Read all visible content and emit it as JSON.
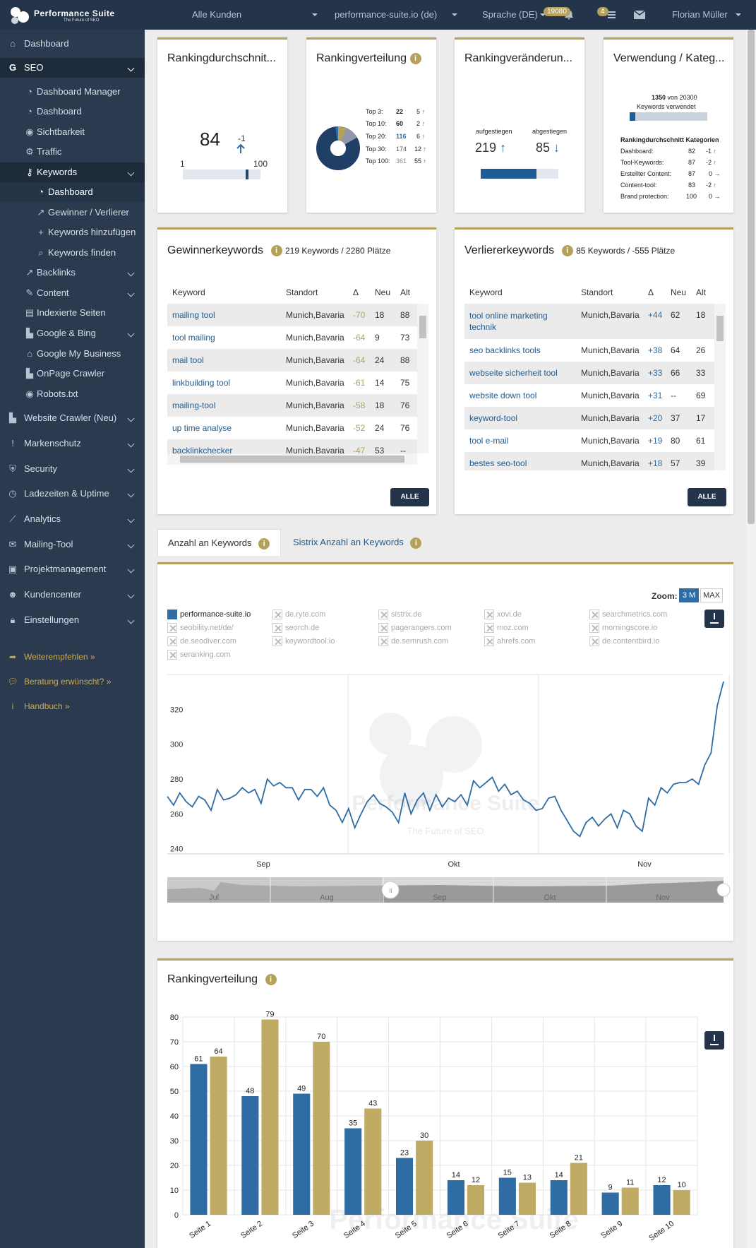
{
  "topbar": {
    "brand": "Performance Suite",
    "tagline": "The Future of SEO",
    "customer": "Alle Kunden",
    "domain": "performance-suite.io (de)",
    "language": "Sprache (DE)",
    "credits": "19080",
    "notifications": "4",
    "user": "Florian Müller"
  },
  "sidebar": {
    "items": [
      {
        "label": "Dashboard",
        "icon": "home-icon"
      },
      {
        "label": "SEO",
        "icon": "google-icon"
      },
      {
        "label": "Dashboard Manager",
        "icon": "dashboard-icon"
      },
      {
        "label": "Dashboard",
        "icon": "dashboard-icon"
      },
      {
        "label": "Sichtbarkeit",
        "icon": "eye-icon"
      },
      {
        "label": "Traffic",
        "icon": "cogs-icon"
      },
      {
        "label": "Keywords",
        "icon": "key-icon"
      },
      {
        "label": "Dashboard",
        "icon": "dashboard-icon"
      },
      {
        "label": "Gewinner / Verlierer",
        "icon": "external-link-icon"
      },
      {
        "label": "Keywords hinzufügen",
        "icon": "plus-icon"
      },
      {
        "label": "Keywords finden",
        "icon": "search-icon"
      },
      {
        "label": "Backlinks",
        "icon": "external-link-icon"
      },
      {
        "label": "Content",
        "icon": "pencil-icon"
      },
      {
        "label": "Indexierte Seiten",
        "icon": "file-icon"
      },
      {
        "label": "Google & Bing",
        "icon": "chart-icon"
      },
      {
        "label": "Google My Business",
        "icon": "store-icon"
      },
      {
        "label": "OnPage Crawler",
        "icon": "chart-icon"
      },
      {
        "label": "Robots.txt",
        "icon": "eye-icon"
      },
      {
        "label": "Website Crawler (Neu)",
        "icon": "chart-icon"
      },
      {
        "label": "Markenschutz",
        "icon": "exclamation-icon"
      },
      {
        "label": "Security",
        "icon": "shield-icon"
      },
      {
        "label": "Ladezeiten & Uptime",
        "icon": "clock-icon"
      },
      {
        "label": "Analytics",
        "icon": "line-chart-icon"
      },
      {
        "label": "Mailing-Tool",
        "icon": "mail-icon"
      },
      {
        "label": "Projektmanagement",
        "icon": "briefcase-icon"
      },
      {
        "label": "Kundencenter",
        "icon": "users-icon"
      },
      {
        "label": "Einstellungen",
        "icon": "lock-icon"
      },
      {
        "label": "Weiterempfehlen »",
        "icon": "share-icon"
      },
      {
        "label": "Beratung erwünscht? »",
        "icon": "chat-icon"
      },
      {
        "label": "Handbuch »",
        "icon": "info-icon"
      }
    ]
  },
  "cards": {
    "avg": {
      "title": "Rankingdurchschnit...",
      "value": "84",
      "change": "-1",
      "min": "1",
      "max": "100",
      "position": 84
    },
    "dist": {
      "title": "Rankingverteilung",
      "rows": [
        {
          "label": "Top 3:",
          "value": "22",
          "delta": "5"
        },
        {
          "label": "Top 10:",
          "value": "60",
          "delta": "2"
        },
        {
          "label": "Top 20:",
          "value": "116",
          "delta": "6"
        },
        {
          "label": "Top 30:",
          "value": "174",
          "delta": "12"
        },
        {
          "label": "Top 100:",
          "value": "361",
          "delta": "55"
        }
      ]
    },
    "change": {
      "title": "Rankingveränderun...",
      "up_label": "aufgestiegen",
      "down_label": "abgestiegen",
      "up": "219",
      "down": "85",
      "up_share": 0.72
    },
    "usage": {
      "title": "Verwendung / Kateg...",
      "used": "1350",
      "of": "von 20300",
      "used_label": "Keywords verwendet",
      "used_share": 0.066,
      "cat_title": "Rankingdurchschnitt Kategorien",
      "cats": [
        {
          "label": "Dashboard:",
          "value": "82",
          "delta": "-1",
          "dir": "up"
        },
        {
          "label": "Tool-Keywords:",
          "value": "87",
          "delta": "-2",
          "dir": "up"
        },
        {
          "label": "Erstellter Content:",
          "value": "87",
          "delta": "0",
          "dir": "right"
        },
        {
          "label": "Content-tool:",
          "value": "83",
          "delta": "-2",
          "dir": "up"
        },
        {
          "label": "Brand protection:",
          "value": "100",
          "delta": "0",
          "dir": "right"
        }
      ]
    }
  },
  "winners": {
    "title": "Gewinnerkeywords",
    "summary": "219 Keywords / 2280 Plätze",
    "headers": [
      "Keyword",
      "Standort",
      "Δ",
      "Neu",
      "Alt"
    ],
    "button": "ALLE",
    "rows": [
      [
        "mailing tool",
        "Munich,Bavaria",
        "-70",
        "18",
        "88"
      ],
      [
        "tool mailing",
        "Munich,Bavaria",
        "-64",
        "9",
        "73"
      ],
      [
        "mail tool",
        "Munich,Bavaria",
        "-64",
        "24",
        "88"
      ],
      [
        "linkbuilding tool",
        "Munich,Bavaria",
        "-61",
        "14",
        "75"
      ],
      [
        "mailing-tool",
        "Munich,Bavaria",
        "-58",
        "18",
        "76"
      ],
      [
        "up time analyse",
        "Munich,Bavaria",
        "-52",
        "24",
        "76"
      ],
      [
        "backlinkchecker",
        "Munich,Bavaria",
        "-47",
        "53",
        "--"
      ]
    ]
  },
  "losers": {
    "title": "Verliererkeywords",
    "summary": "85 Keywords / -555 Plätze",
    "headers": [
      "Keyword",
      "Standort",
      "Δ",
      "Neu",
      "Alt"
    ],
    "button": "ALLE",
    "rows": [
      [
        "tool online marketing technik",
        "Munich,Bavaria",
        "+44",
        "62",
        "18"
      ],
      [
        "seo backlinks tools",
        "Munich,Bavaria",
        "+38",
        "64",
        "26"
      ],
      [
        "webseite sicherheit tool",
        "Munich,Bavaria",
        "+33",
        "66",
        "33"
      ],
      [
        "website down tool",
        "Munich,Bavaria",
        "+31",
        "--",
        "69"
      ],
      [
        "keyword-tool",
        "Munich,Bavaria",
        "+20",
        "37",
        "17"
      ],
      [
        "tool e-mail",
        "Munich,Bavaria",
        "+19",
        "80",
        "61"
      ],
      [
        "bestes seo-tool",
        "Munich,Bavaria",
        "+18",
        "57",
        "39"
      ]
    ]
  },
  "tabs": [
    {
      "label": "Anzahl an Keywords"
    },
    {
      "label": "Sistrix Anzahl an Keywords"
    }
  ],
  "linechart": {
    "zoom_label": "Zoom:",
    "zoom_options": [
      "3 M",
      "MAX"
    ],
    "legend": [
      "performance-suite.io",
      "de.ryte.com",
      "sistrix.de",
      "xovi.de",
      "searchmetrics.com",
      "seobility.net/de/",
      "seorch.de",
      "pagerangers.com",
      "moz.com",
      "morningscore.io",
      "de.seodiver.com",
      "keywordtool.io",
      "de.semrush.com",
      "ahrefs.com",
      "de.contentbird.io",
      "seranking.com"
    ],
    "navigator_labels": [
      "Jul",
      "Aug",
      "Sep",
      "Okt",
      "Nov"
    ],
    "watermark": "Performance Suite",
    "watermark_sub": "The Future of SEO"
  },
  "barchart": {
    "title": "Rankingverteilung",
    "watermark": "Performance Suite"
  },
  "chart_data": [
    {
      "type": "line",
      "series": [
        {
          "name": "performance-suite.io",
          "values": [
            270,
            265,
            272,
            267,
            264,
            270,
            268,
            262,
            274,
            268,
            269,
            271,
            275,
            272,
            274,
            266,
            280,
            276,
            278,
            275,
            275,
            268,
            274,
            274,
            270,
            275,
            265,
            262,
            255,
            263,
            252,
            260,
            267,
            271,
            266,
            264,
            261,
            255,
            272,
            260,
            268,
            272,
            262,
            271,
            264,
            269,
            267,
            271,
            265,
            279,
            275,
            278,
            281,
            273,
            277,
            271,
            273,
            268,
            266,
            262,
            263,
            269,
            270,
            262,
            256,
            250,
            247,
            255,
            258,
            253,
            257,
            260,
            252,
            262,
            260,
            253,
            250,
            269,
            265,
            275,
            272,
            277,
            278,
            278,
            280,
            277,
            288,
            295,
            322,
            336
          ]
        }
      ],
      "x_ticks": [
        "Sep",
        "Okt",
        "Nov"
      ],
      "y_ticks": [
        240,
        260,
        280,
        300,
        320
      ],
      "ylim": [
        237,
        340
      ]
    },
    {
      "type": "bar",
      "categories": [
        "Seite 1",
        "Seite 2",
        "Seite 3",
        "Seite 4",
        "Seite 5",
        "Seite 6",
        "Seite 7",
        "Seite 8",
        "Seite 9",
        "Seite 10"
      ],
      "series": [
        {
          "values": [
            61,
            48,
            49,
            35,
            23,
            14,
            15,
            14,
            9,
            12
          ]
        },
        {
          "values": [
            64,
            79,
            70,
            43,
            30,
            12,
            13,
            21,
            11,
            10
          ]
        }
      ],
      "colors": [
        "#2f6ca3",
        "#c0ab64"
      ],
      "y_ticks": [
        0,
        10,
        20,
        30,
        40,
        50,
        60,
        70,
        80
      ],
      "ylim": [
        0,
        80
      ]
    }
  ]
}
